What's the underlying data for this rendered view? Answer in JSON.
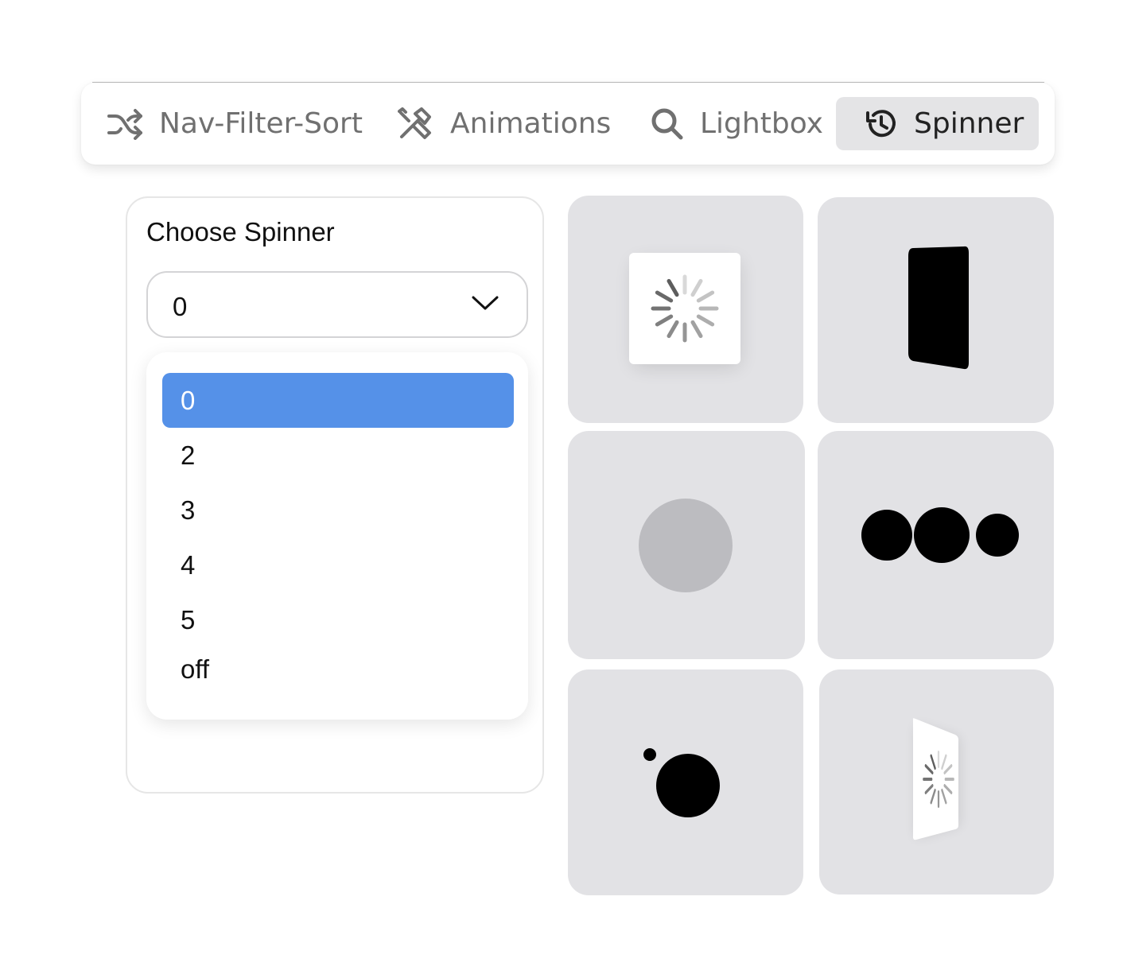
{
  "nav": {
    "items": [
      {
        "label": "Nav-Filter-Sort",
        "icon": "shuffle-icon"
      },
      {
        "label": "Animations",
        "icon": "tools-icon"
      },
      {
        "label": "Lightbox",
        "icon": "search-icon"
      },
      {
        "label": "Spinner",
        "icon": "history-icon"
      }
    ],
    "active_index": 3
  },
  "panel": {
    "title": "Choose Spinner",
    "select_value": "0",
    "options": [
      "0",
      "2",
      "3",
      "4",
      "5",
      "off"
    ],
    "selected_option": "0"
  },
  "tiles": [
    {
      "icon": "ios-spinner-card-icon"
    },
    {
      "icon": "flipping-card-icon"
    },
    {
      "icon": "pulsing-circle-icon"
    },
    {
      "icon": "three-dots-icon"
    },
    {
      "icon": "orbit-dot-icon"
    },
    {
      "icon": "tilted-spinner-card-icon"
    }
  ],
  "colors": {
    "accent": "#5591e8",
    "tile_bg": "#e2e2e5",
    "active_tab_bg": "#e4e4e6",
    "nav_text": "#707070"
  }
}
